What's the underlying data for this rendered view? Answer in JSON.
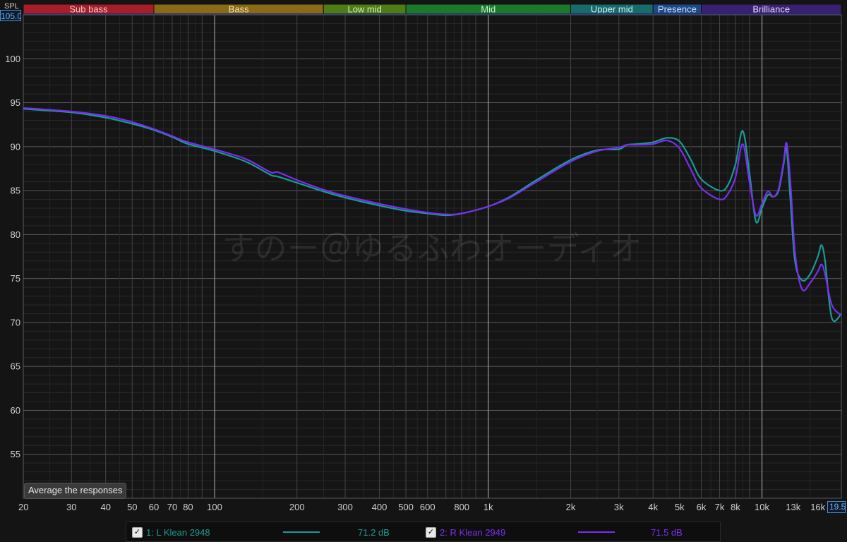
{
  "spl_label": "SPL",
  "spl_max_value": "105.00",
  "x_max_value": "19.5",
  "watermark": "すのー＠ゆるふわオーディオ",
  "average_button": "Average the responses",
  "bands": [
    {
      "label": "Sub bass",
      "from": 20,
      "to": 60,
      "color": "#a81d28",
      "text": "#f0c8c8"
    },
    {
      "label": "Bass",
      "from": 60,
      "to": 250,
      "color": "#8a6a14",
      "text": "#f2e2b0"
    },
    {
      "label": "Low mid",
      "from": 250,
      "to": 500,
      "color": "#4e7d16",
      "text": "#d8f0b8"
    },
    {
      "label": "Mid",
      "from": 500,
      "to": 2000,
      "color": "#1a7a2a",
      "text": "#c8f0c8"
    },
    {
      "label": "Upper mid",
      "from": 2000,
      "to": 4000,
      "color": "#176b6b",
      "text": "#c8f0f0"
    },
    {
      "label": "Presence",
      "from": 4000,
      "to": 6000,
      "color": "#1d4a86",
      "text": "#c8dcff"
    },
    {
      "label": "Brilliance",
      "from": 6000,
      "to": 19500,
      "color": "#3a2070",
      "text": "#e2d4ff"
    }
  ],
  "legend": [
    {
      "checked": "✓",
      "name": "1: L Klean 2948",
      "value": "71.2 dB",
      "color": "#1a9a92"
    },
    {
      "checked": "✓",
      "name": "2: R Klean 2949",
      "value": "71.5 dB",
      "color": "#7a2ef0"
    }
  ],
  "chart_data": {
    "type": "line",
    "xscale": "log",
    "xlim": [
      20,
      19500
    ],
    "ylim": [
      50,
      105
    ],
    "ylabel": "SPL",
    "y_ticks": [
      55,
      60,
      65,
      70,
      75,
      80,
      85,
      90,
      95,
      100
    ],
    "x_ticks": [
      {
        "v": 20,
        "l": "20"
      },
      {
        "v": 30,
        "l": "30"
      },
      {
        "v": 40,
        "l": "40"
      },
      {
        "v": 50,
        "l": "50"
      },
      {
        "v": 60,
        "l": "60"
      },
      {
        "v": 70,
        "l": "70"
      },
      {
        "v": 80,
        "l": "80"
      },
      {
        "v": 100,
        "l": "100"
      },
      {
        "v": 200,
        "l": "200"
      },
      {
        "v": 300,
        "l": "300"
      },
      {
        "v": 400,
        "l": "400"
      },
      {
        "v": 500,
        "l": "500"
      },
      {
        "v": 600,
        "l": "600"
      },
      {
        "v": 800,
        "l": "800"
      },
      {
        "v": 1000,
        "l": "1k"
      },
      {
        "v": 2000,
        "l": "2k"
      },
      {
        "v": 3000,
        "l": "3k"
      },
      {
        "v": 4000,
        "l": "4k"
      },
      {
        "v": 5000,
        "l": "5k"
      },
      {
        "v": 6000,
        "l": "6k"
      },
      {
        "v": 7000,
        "l": "7k"
      },
      {
        "v": 8000,
        "l": "8k"
      },
      {
        "v": 10000,
        "l": "10k"
      },
      {
        "v": 13000,
        "l": "13k"
      },
      {
        "v": 16000,
        "l": "16k"
      }
    ],
    "grid": true,
    "series": [
      {
        "name": "1: L Klean 2948",
        "color": "#1a9a92",
        "points": [
          [
            20,
            94.3
          ],
          [
            30,
            93.9
          ],
          [
            40,
            93.3
          ],
          [
            50,
            92.6
          ],
          [
            60,
            91.9
          ],
          [
            70,
            91.1
          ],
          [
            80,
            90.3
          ],
          [
            100,
            89.5
          ],
          [
            130,
            88.3
          ],
          [
            160,
            86.8
          ],
          [
            170,
            86.6
          ],
          [
            200,
            85.9
          ],
          [
            250,
            84.9
          ],
          [
            300,
            84.2
          ],
          [
            400,
            83.3
          ],
          [
            500,
            82.7
          ],
          [
            600,
            82.4
          ],
          [
            700,
            82.2
          ],
          [
            800,
            82.4
          ],
          [
            1000,
            83.2
          ],
          [
            1200,
            84.3
          ],
          [
            1500,
            86.2
          ],
          [
            2000,
            88.5
          ],
          [
            2500,
            89.6
          ],
          [
            3000,
            89.7
          ],
          [
            3200,
            90.2
          ],
          [
            3500,
            90.3
          ],
          [
            4000,
            90.5
          ],
          [
            4500,
            91.0
          ],
          [
            5000,
            90.6
          ],
          [
            5500,
            88.5
          ],
          [
            6000,
            86.3
          ],
          [
            7000,
            85.0
          ],
          [
            7500,
            85.6
          ],
          [
            8000,
            88.0
          ],
          [
            8500,
            91.8
          ],
          [
            9000,
            87.0
          ],
          [
            9500,
            81.5
          ],
          [
            10000,
            83.0
          ],
          [
            10500,
            84.5
          ],
          [
            11000,
            84.3
          ],
          [
            11500,
            85.0
          ],
          [
            12000,
            88.0
          ],
          [
            12300,
            89.8
          ],
          [
            12700,
            84.0
          ],
          [
            13200,
            77.0
          ],
          [
            14000,
            74.8
          ],
          [
            15000,
            75.5
          ],
          [
            16000,
            77.5
          ],
          [
            16500,
            78.8
          ],
          [
            17000,
            77.0
          ],
          [
            18000,
            70.5
          ],
          [
            19500,
            71.0
          ]
        ]
      },
      {
        "name": "2: R Klean 2949",
        "color": "#7a2ef0",
        "points": [
          [
            20,
            94.4
          ],
          [
            30,
            94.0
          ],
          [
            40,
            93.5
          ],
          [
            50,
            92.8
          ],
          [
            60,
            92.0
          ],
          [
            70,
            91.2
          ],
          [
            80,
            90.5
          ],
          [
            100,
            89.7
          ],
          [
            130,
            88.6
          ],
          [
            160,
            87.1
          ],
          [
            170,
            87.1
          ],
          [
            200,
            86.2
          ],
          [
            250,
            85.1
          ],
          [
            300,
            84.4
          ],
          [
            400,
            83.5
          ],
          [
            500,
            82.9
          ],
          [
            600,
            82.5
          ],
          [
            700,
            82.3
          ],
          [
            800,
            82.4
          ],
          [
            1000,
            83.2
          ],
          [
            1200,
            84.2
          ],
          [
            1500,
            86.0
          ],
          [
            2000,
            88.3
          ],
          [
            2500,
            89.5
          ],
          [
            3000,
            89.9
          ],
          [
            3200,
            90.2
          ],
          [
            3500,
            90.2
          ],
          [
            4000,
            90.3
          ],
          [
            4500,
            90.7
          ],
          [
            5000,
            89.8
          ],
          [
            5500,
            87.4
          ],
          [
            6000,
            85.3
          ],
          [
            7000,
            84.0
          ],
          [
            7500,
            84.6
          ],
          [
            8000,
            86.5
          ],
          [
            8500,
            90.3
          ],
          [
            9000,
            86.0
          ],
          [
            9500,
            82.2
          ],
          [
            10000,
            83.5
          ],
          [
            10500,
            84.9
          ],
          [
            11000,
            84.3
          ],
          [
            11500,
            85.2
          ],
          [
            12000,
            88.3
          ],
          [
            12300,
            90.4
          ],
          [
            12700,
            86.0
          ],
          [
            13200,
            78.0
          ],
          [
            14000,
            73.8
          ],
          [
            15000,
            74.5
          ],
          [
            16000,
            75.8
          ],
          [
            16500,
            76.6
          ],
          [
            17000,
            75.5
          ],
          [
            18000,
            72.0
          ],
          [
            19500,
            70.8
          ]
        ]
      }
    ]
  }
}
